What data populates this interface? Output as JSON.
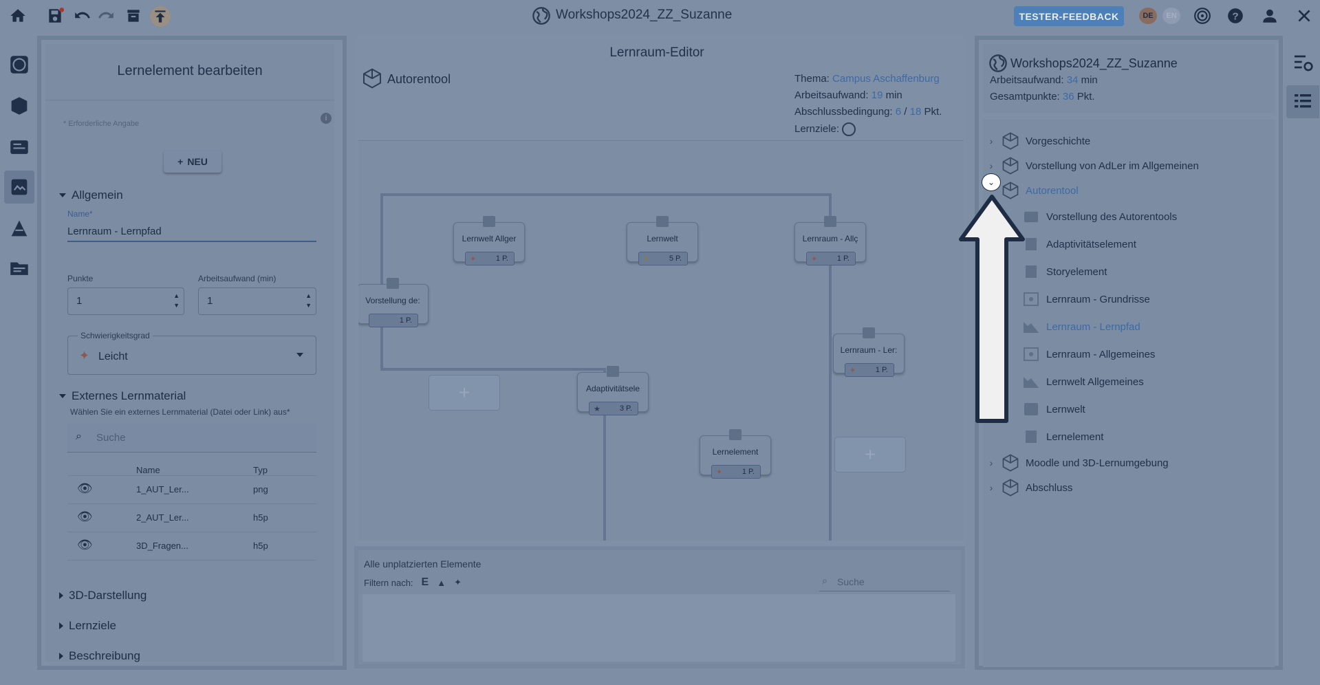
{
  "topbar": {
    "project_title": "Workshops2024_ZZ_Suzanne",
    "feedback_label": "TESTER-FEEDBACK",
    "lang_de": "DE",
    "lang_en": "EN"
  },
  "left_panel": {
    "heading": "Lernelement bearbeiten",
    "required_note": "* Erforderliche Angabe",
    "new_button": "NEU",
    "section_general": "Allgemein",
    "name_label": "Name*",
    "name_value": "Lernraum - Lernpfad",
    "points_label": "Punkte",
    "points_value": "1",
    "workload_label": "Arbeitsaufwand (min)",
    "workload_value": "1",
    "difficulty_label": "Schwierigkeitsgrad",
    "difficulty_value": "Leicht",
    "section_external": "Externes Lernmaterial",
    "external_hint": "Wählen Sie ein externes Lernmaterial (Datei oder Link) aus*",
    "search_placeholder": "Suche",
    "table_header_name": "Name",
    "table_header_type": "Typ",
    "materials": [
      {
        "name": "1_AUT_Ler...",
        "type": "png"
      },
      {
        "name": "2_AUT_Ler...",
        "type": "h5p"
      },
      {
        "name": "3D_Fragen...",
        "type": "h5p"
      }
    ],
    "section_3d": "3D-Darstellung",
    "section_goals": "Lernziele",
    "section_desc": "Beschreibung"
  },
  "center": {
    "title": "Lernraum-Editor",
    "room_name": "Autorentool",
    "theme_label": "Thema:",
    "theme_value": "Campus Aschaffenburg",
    "workload_label": "Arbeitsaufwand:",
    "workload_value": "19",
    "workload_unit": "min",
    "completion_label": "Abschlussbedingung:",
    "completion_value": "6",
    "completion_sep": "/",
    "completion_total": "18",
    "completion_unit": "Pkt.",
    "goals_label": "Lernziele:",
    "elements": [
      {
        "label": "Lernwelt Allger",
        "points": "1 P."
      },
      {
        "label": "Lernwelt",
        "points": "5 P."
      },
      {
        "label": "Lernraum - Allç",
        "points": "1 P."
      },
      {
        "label": "Vorstellung de:",
        "points": "1 P."
      },
      {
        "label": "Lernraum - Ler:",
        "points": "1 P."
      },
      {
        "label": "Adaptivitätsele",
        "points": "3 P."
      },
      {
        "label": "Lernelement",
        "points": "1 P."
      }
    ],
    "unplaced_title": "Alle unplatzierten Elemente",
    "filter_label": "Filtern nach:",
    "filter_e": "E",
    "bottom_search": "Suche"
  },
  "right_panel": {
    "world_title": "Workshops2024_ZZ_Suzanne",
    "workload_label": "Arbeitsaufwand:",
    "workload_value": "34",
    "workload_unit": "min",
    "points_label": "Gesamtpunkte:",
    "points_value": "36",
    "points_unit": "Pkt.",
    "spaces": [
      "Vorgeschichte",
      "Vorstellung von AdLer im Allgemeinen",
      "Autorentool",
      "Moodle und 3D-Lernumgebung",
      "Abschluss"
    ],
    "autorentool_children": [
      "Vorstellung des Autorentools",
      "Adaptivitätselement",
      "Storyelement",
      "Lernraum - Grundrisse",
      "Lernraum - Lernpfad",
      "Lernraum - Allgemeines",
      "Lernwelt Allgemeines",
      "Lernwelt",
      "Lernelement"
    ]
  },
  "colors": {
    "accent": "#3d6aa4",
    "feedback": "#4d7fb8",
    "overlay_bg": "#7d8ea5",
    "highlight": "#ffffff",
    "arrow_outline": "#1f2d44"
  }
}
